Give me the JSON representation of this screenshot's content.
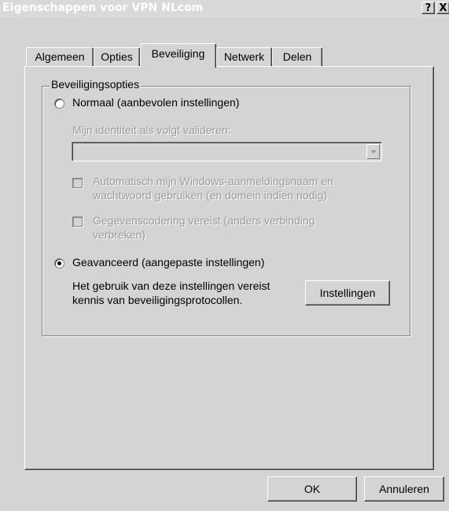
{
  "window": {
    "title": "Eigenschappen voor VPN NLcom",
    "help_label": "?",
    "close_label": "X"
  },
  "tabs": [
    {
      "label": "Algemeen"
    },
    {
      "label": "Opties"
    },
    {
      "label": "Beveiliging",
      "active": true
    },
    {
      "label": "Netwerk"
    },
    {
      "label": "Delen"
    }
  ],
  "security": {
    "group_title": "Beveiligingsopties",
    "normal_label": "Normaal (aanbevolen instellingen)",
    "identity_label": "Mijn identiteit als volgt valideren:",
    "identity_value": "",
    "auto_windows_line1": "Automatisch mijn Windows-aanmeldingsnaam en",
    "auto_windows_line2": "wachtwoord gebruiken (en domein indien nodig)",
    "encryption_line1": "Gegevenscodering vereist (anders verbinding",
    "encryption_line2": "verbreken)",
    "advanced_label": "Geavanceerd (aangepaste instellingen)",
    "advanced_desc_line1": "Het gebruik van deze instellingen vereist",
    "advanced_desc_line2": "kennis van beveiligingsprotocollen.",
    "settings_button": "Instellingen",
    "selected": "advanced"
  },
  "footer": {
    "ok_label": "OK",
    "cancel_label": "Annuleren"
  }
}
